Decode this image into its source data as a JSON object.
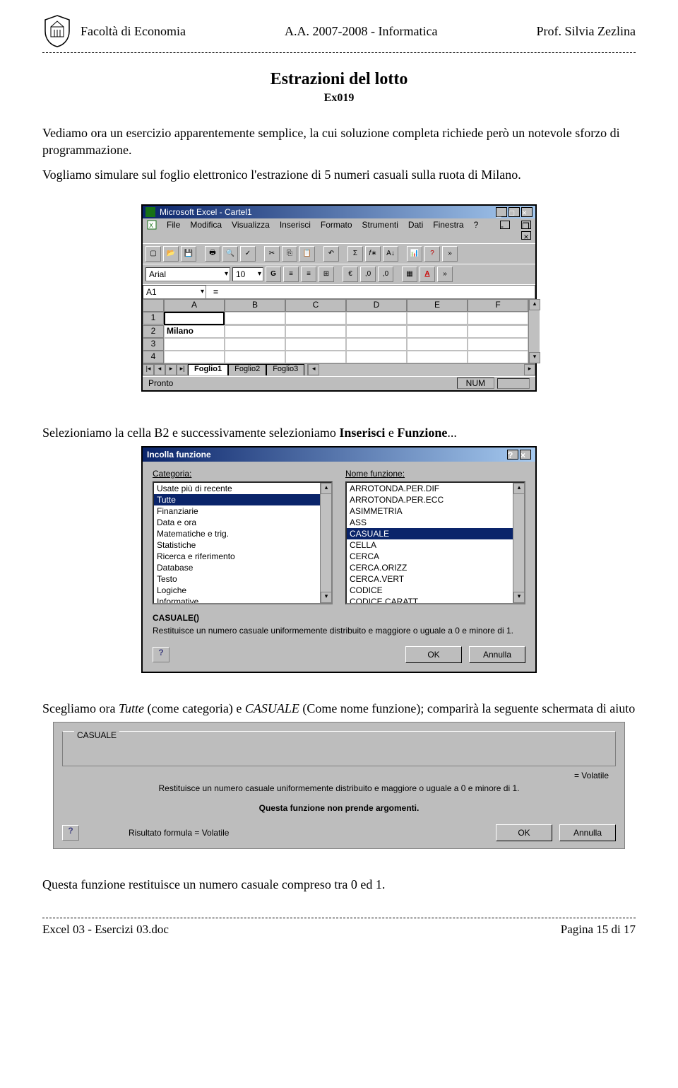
{
  "header": {
    "left": "Facoltà di Economia",
    "center": "A.A. 2007-2008 - Informatica",
    "right": "Prof. Silvia Zezlina"
  },
  "title": "Estrazioni del lotto",
  "subtitle": "Ex019",
  "intro1": "Vediamo ora un esercizio apparentemente semplice, la cui soluzione completa richiede però un notevole sforzo di programmazione.",
  "intro2": "Vogliamo simulare sul foglio elettronico l'estrazione di 5 numeri casuali sulla ruota di Milano.",
  "excel1": {
    "titlebar": "Microsoft Excel - Cartel1",
    "menus": [
      "File",
      "Modifica",
      "Visualizza",
      "Inserisci",
      "Formato",
      "Strumenti",
      "Dati",
      "Finestra",
      "?"
    ],
    "font": "Arial",
    "size": "10",
    "namebox": "A1",
    "cols": [
      "A",
      "B",
      "C",
      "D",
      "E",
      "F"
    ],
    "rows": [
      "1",
      "2",
      "3",
      "4"
    ],
    "a2": "Milano",
    "tabs": [
      "Foglio1",
      "Foglio2",
      "Foglio3"
    ],
    "status": "Pronto",
    "num": "NUM"
  },
  "mid1a": "Selezioniamo la cella B2 e successivamente selezioniamo ",
  "mid1b": "Inserisci",
  "mid1c": " e ",
  "mid1d": "Funzione",
  "mid1e": "...",
  "dialog1": {
    "title": "Incolla funzione",
    "catLabel": "Categoria:",
    "funcLabel": "Nome funzione:",
    "cats": [
      "Usate più di recente",
      "Tutte",
      "Finanziarie",
      "Data e ora",
      "Matematiche e trig.",
      "Statistiche",
      "Ricerca e riferimento",
      "Database",
      "Testo",
      "Logiche",
      "Informative"
    ],
    "catSel": 1,
    "funcs": [
      "ARROTONDA.PER.DIF",
      "ARROTONDA.PER.ECC",
      "ASIMMETRIA",
      "ASS",
      "CASUALE",
      "CELLA",
      "CERCA",
      "CERCA.ORIZZ",
      "CERCA.VERT",
      "CODICE",
      "CODICE.CARATT"
    ],
    "funcSel": 4,
    "fname": "CASUALE()",
    "fdesc": "Restituisce un numero casuale uniformemente distribuito e maggiore o uguale a 0 e minore di 1.",
    "ok": "OK",
    "cancel": "Annulla"
  },
  "mid2a": "Scegliamo ora ",
  "mid2b": "Tutte",
  "mid2c": " (come categoria) e ",
  "mid2d": "CASUALE",
  "mid2e": " (Come nome funzione); comparirà la seguente schermata di aiuto",
  "dialog2": {
    "grp": "CASUALE",
    "vol": "= Volatile",
    "desc": "Restituisce un numero casuale uniformemente distribuito e maggiore o uguale a 0 e minore di 1.",
    "noargs": "Questa funzione non prende argomenti.",
    "res": "Risultato formula = Volatile",
    "ok": "OK",
    "cancel": "Annulla"
  },
  "closing": "Questa funzione restituisce un numero casuale compreso tra 0 ed 1.",
  "footer": {
    "left": "Excel 03 - Esercizi 03.doc",
    "right": "Pagina 15 di 17"
  },
  "icons": {
    "help": "?",
    "close": "×",
    "min": "_",
    "max": "□"
  }
}
